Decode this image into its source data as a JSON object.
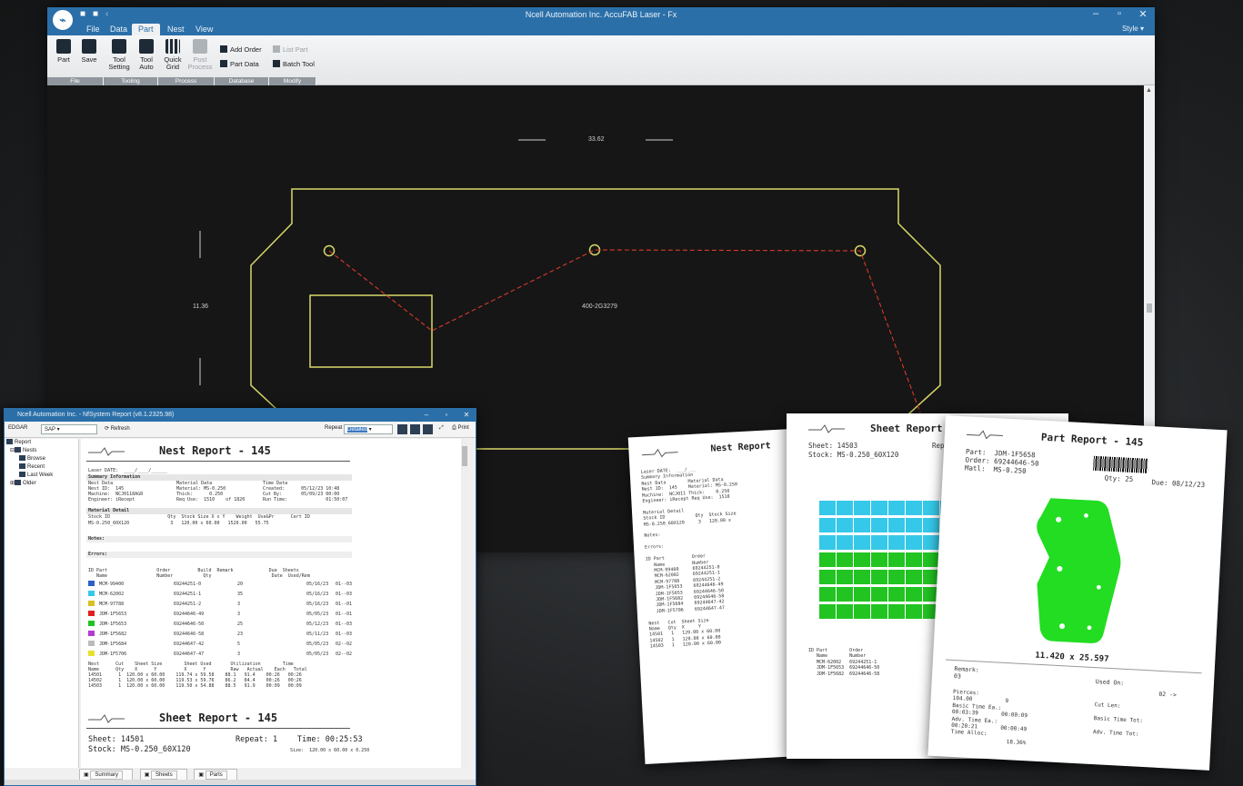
{
  "app": {
    "title": "Ncell Automation Inc. AccuFAB Laser - Fx",
    "menu_tabs": [
      {
        "label": "File"
      },
      {
        "label": "Data"
      },
      {
        "label": "Part"
      },
      {
        "label": "Nest"
      },
      {
        "label": "View"
      }
    ],
    "active_tab": "Part",
    "style_label": "Style",
    "ribbon": {
      "part": "Part",
      "save": "Save",
      "tool_setting_1": "Tool",
      "tool_setting_2": "Setting",
      "tool_auto_1": "Tool",
      "tool_auto_2": "Auto",
      "quick_grid_1": "Quick",
      "quick_grid_2": "Grid",
      "post_process_1": "Post",
      "post_process_2": "Process",
      "add_order": "Add Order",
      "part_data": "Part Data",
      "list_part": "List Part",
      "batch_tool": "Batch Tool",
      "groups": [
        {
          "label": "File"
        },
        {
          "label": "Tooling"
        },
        {
          "label": "Process"
        },
        {
          "label": "Database"
        },
        {
          "label": "Modify"
        }
      ]
    },
    "canvas": {
      "width_dim": "33.62",
      "height_dim": "11.36",
      "part_label": "400-2G3279",
      "colors": {
        "outline": "#d8d86a",
        "path": "#d93a2a",
        "background": "#161616"
      }
    }
  },
  "report": {
    "window_title": "Ncell Automation Inc. - NfSystem Report (v8.1.2325.98)",
    "toolbar": {
      "printer_label": "EDGAR",
      "printer_value": "SAP",
      "refresh": "Refresh",
      "repeat_label": "Repeat",
      "repeat_value": "Detailed",
      "print": "Print"
    },
    "tree": [
      {
        "label": "Report"
      },
      {
        "label": "Nests"
      },
      {
        "label": "Browse"
      },
      {
        "label": "Recent"
      },
      {
        "label": "Last Week"
      },
      {
        "label": "Older"
      }
    ],
    "nest_title": "Nest Report - 145",
    "laser_date": "Laser DATE:  ____/____/______",
    "summary_header": "Summary Information",
    "nest_data_block": "Nest Data\nNest ID:  145\nMachine:  NCJ0118AGR\nEngineer: iRecept",
    "material_block": "Material Data\nMaterial: MS-0.250\nThick:      0.250\nReq Use:  1510    of 1820",
    "time_block": "Time Data\nCreated:      05/12/23 10:48\nCut By:       05/09/23 00:00\nRun Time:              01:50:07",
    "material_detail_header": "Material Detail",
    "stock_header": "Stock ID                     Qty  Stock Size X x Y    Weight  Use&Pr      Cert ID",
    "stock_row": "MS-0.250_60X120               3   120.00 x 60.00   1520.00   55.75",
    "notes_label": "Notes:",
    "errors_label": "Errors:",
    "parts_header": "ID Part                  Order          Build  Remark             Due  Sheets\n   Name                  Number           Qty                      Date  Used/Rem",
    "parts": [
      {
        "name": "MCM-99400",
        "order": "69244251-0",
        "qty": "20",
        "due": "05/16/23",
        "sheets": "01--03",
        "color": "#2a5fc8"
      },
      {
        "name": "MCM-62002",
        "order": "69244251-1",
        "qty": "35",
        "due": "05/16/23",
        "sheets": "01--03",
        "color": "#36c8e8"
      },
      {
        "name": "MCM-97788",
        "order": "69244251-2",
        "qty": "3",
        "due": "05/16/23",
        "sheets": "01--01",
        "color": "#d8c020"
      },
      {
        "name": "JDM-1F5653",
        "order": "69244646-49",
        "qty": "3",
        "due": "05/05/23",
        "sheets": "01--01",
        "color": "#e02020"
      },
      {
        "name": "JDM-1F5653",
        "order": "69244646-50",
        "qty": "25",
        "due": "05/12/23",
        "sheets": "01--03",
        "color": "#22c422"
      },
      {
        "name": "JDM-1F5682",
        "order": "69244646-58",
        "qty": "23",
        "due": "05/11/23",
        "sheets": "01--03",
        "color": "#b43ad2"
      },
      {
        "name": "JDM-1F5684",
        "order": "69244647-42",
        "qty": "5",
        "due": "05/05/23",
        "sheets": "02--02",
        "color": "#bbbbbb"
      },
      {
        "name": "JDM-1F5706",
        "order": "69244647-47",
        "qty": "3",
        "due": "05/05/23",
        "sheets": "02--02",
        "color": "#e8e030"
      }
    ],
    "sheets_table": "Nest      Cut    Sheet Size        Sheet Used       Utilization        Time\nName      Qty    X      Y          X      Y         Raw   Actual    Each   Total\n14501      1  120.00 x 60.00    119.74 x 59.58    88.1   91.4    00:26   00:26\n14502      1  120.00 x 60.00    119.53 x 59.76    86.2   84.4    00:26   00:26\n14503      1  120.00 x 60.00    119.50 x 54.88    88.5   91.9    00:09   00:09",
    "sheet_title": "Sheet Report - 145",
    "sheet_line1": "Sheet: 14501",
    "sheet_repeat": "Repeat:  1",
    "sheet_time": "Time: 00:25:53",
    "sheet_line2": "Stock: MS-0.250_60X120",
    "sheet_size": "Size:  120.00 x 60.00 x 0.250",
    "bottom_tabs": [
      {
        "label": "Summary"
      },
      {
        "label": "Sheets"
      },
      {
        "label": "Parts"
      }
    ]
  },
  "papers": {
    "nest": {
      "title": "Nest Report",
      "body": "Laser DATE:  ___/___\nSummary Information\nNest Data        Material Data\nNest ID:  145    Material: MS-0.250\nMachine:  NCJ011 Thick:    0.250\nEngineer: iRecept Req Use:  1510\n\nMaterial Detail\nStock ID           Qty  Stock Size\nMS-0.250_60X120     3   120.00 x\n\nNotes:\n\nErrors:\n\nID Part          Order\n   Name          Number\n   MCM-99400     69244251-0\n   MCM-62002     69244251-1\n   MCM-97788     69244251-2\n   JDM-1F5653    69244646-49\n   JDM-1F5653    69244646-50\n   JDM-1F5682    69244646-58\n   JDM-1F5684    69244647-42\n   JDM-1F5706    69244647-47\n\nNest   Cut  Sheet Size\nName   Qty  X     Y\n14501   1   120.00 x 60.00\n14502   1   120.00 x 60.00\n14503   1   120.00 x 60.00"
    },
    "sheet": {
      "title": "Sheet Report - 1",
      "line1": "Sheet: 14503",
      "repeat": "Repeat:  1",
      "line2": "Stock: MS-0.250_60X120",
      "legend": "ID Part        Order\n   Name        Number\n   MCM-62002   69244251-1\n   JDM-1F5653  69244646-50\n   JDM-1F5682  69244646-58"
    },
    "part": {
      "title": "Part Report - 145",
      "part_line": "Part:  JDM-1F5658",
      "order_line": "Order: 69244646-50",
      "matl_line": "Matl:  MS-0.250",
      "qty": "Qty: 25",
      "due": "Due: 08/12/23",
      "size": "11.420 x 25.597",
      "remark": "Remark:\n03",
      "used_on": "Used On:",
      "used_on_value": "02 ->",
      "stats_left": "Pierces:\n104.00          9\nBasic Time Ea.:\n00:03:39       00:00:09\nAdv. Time Ea.:\n00:20:21       00:00:49\nTime Alloc:\n                 18.36%",
      "stats_right": "Cut Len:\n\nBasic Time Tot:\n\nAdv. Time Tot:",
      "part_color": "#22dd22"
    }
  }
}
